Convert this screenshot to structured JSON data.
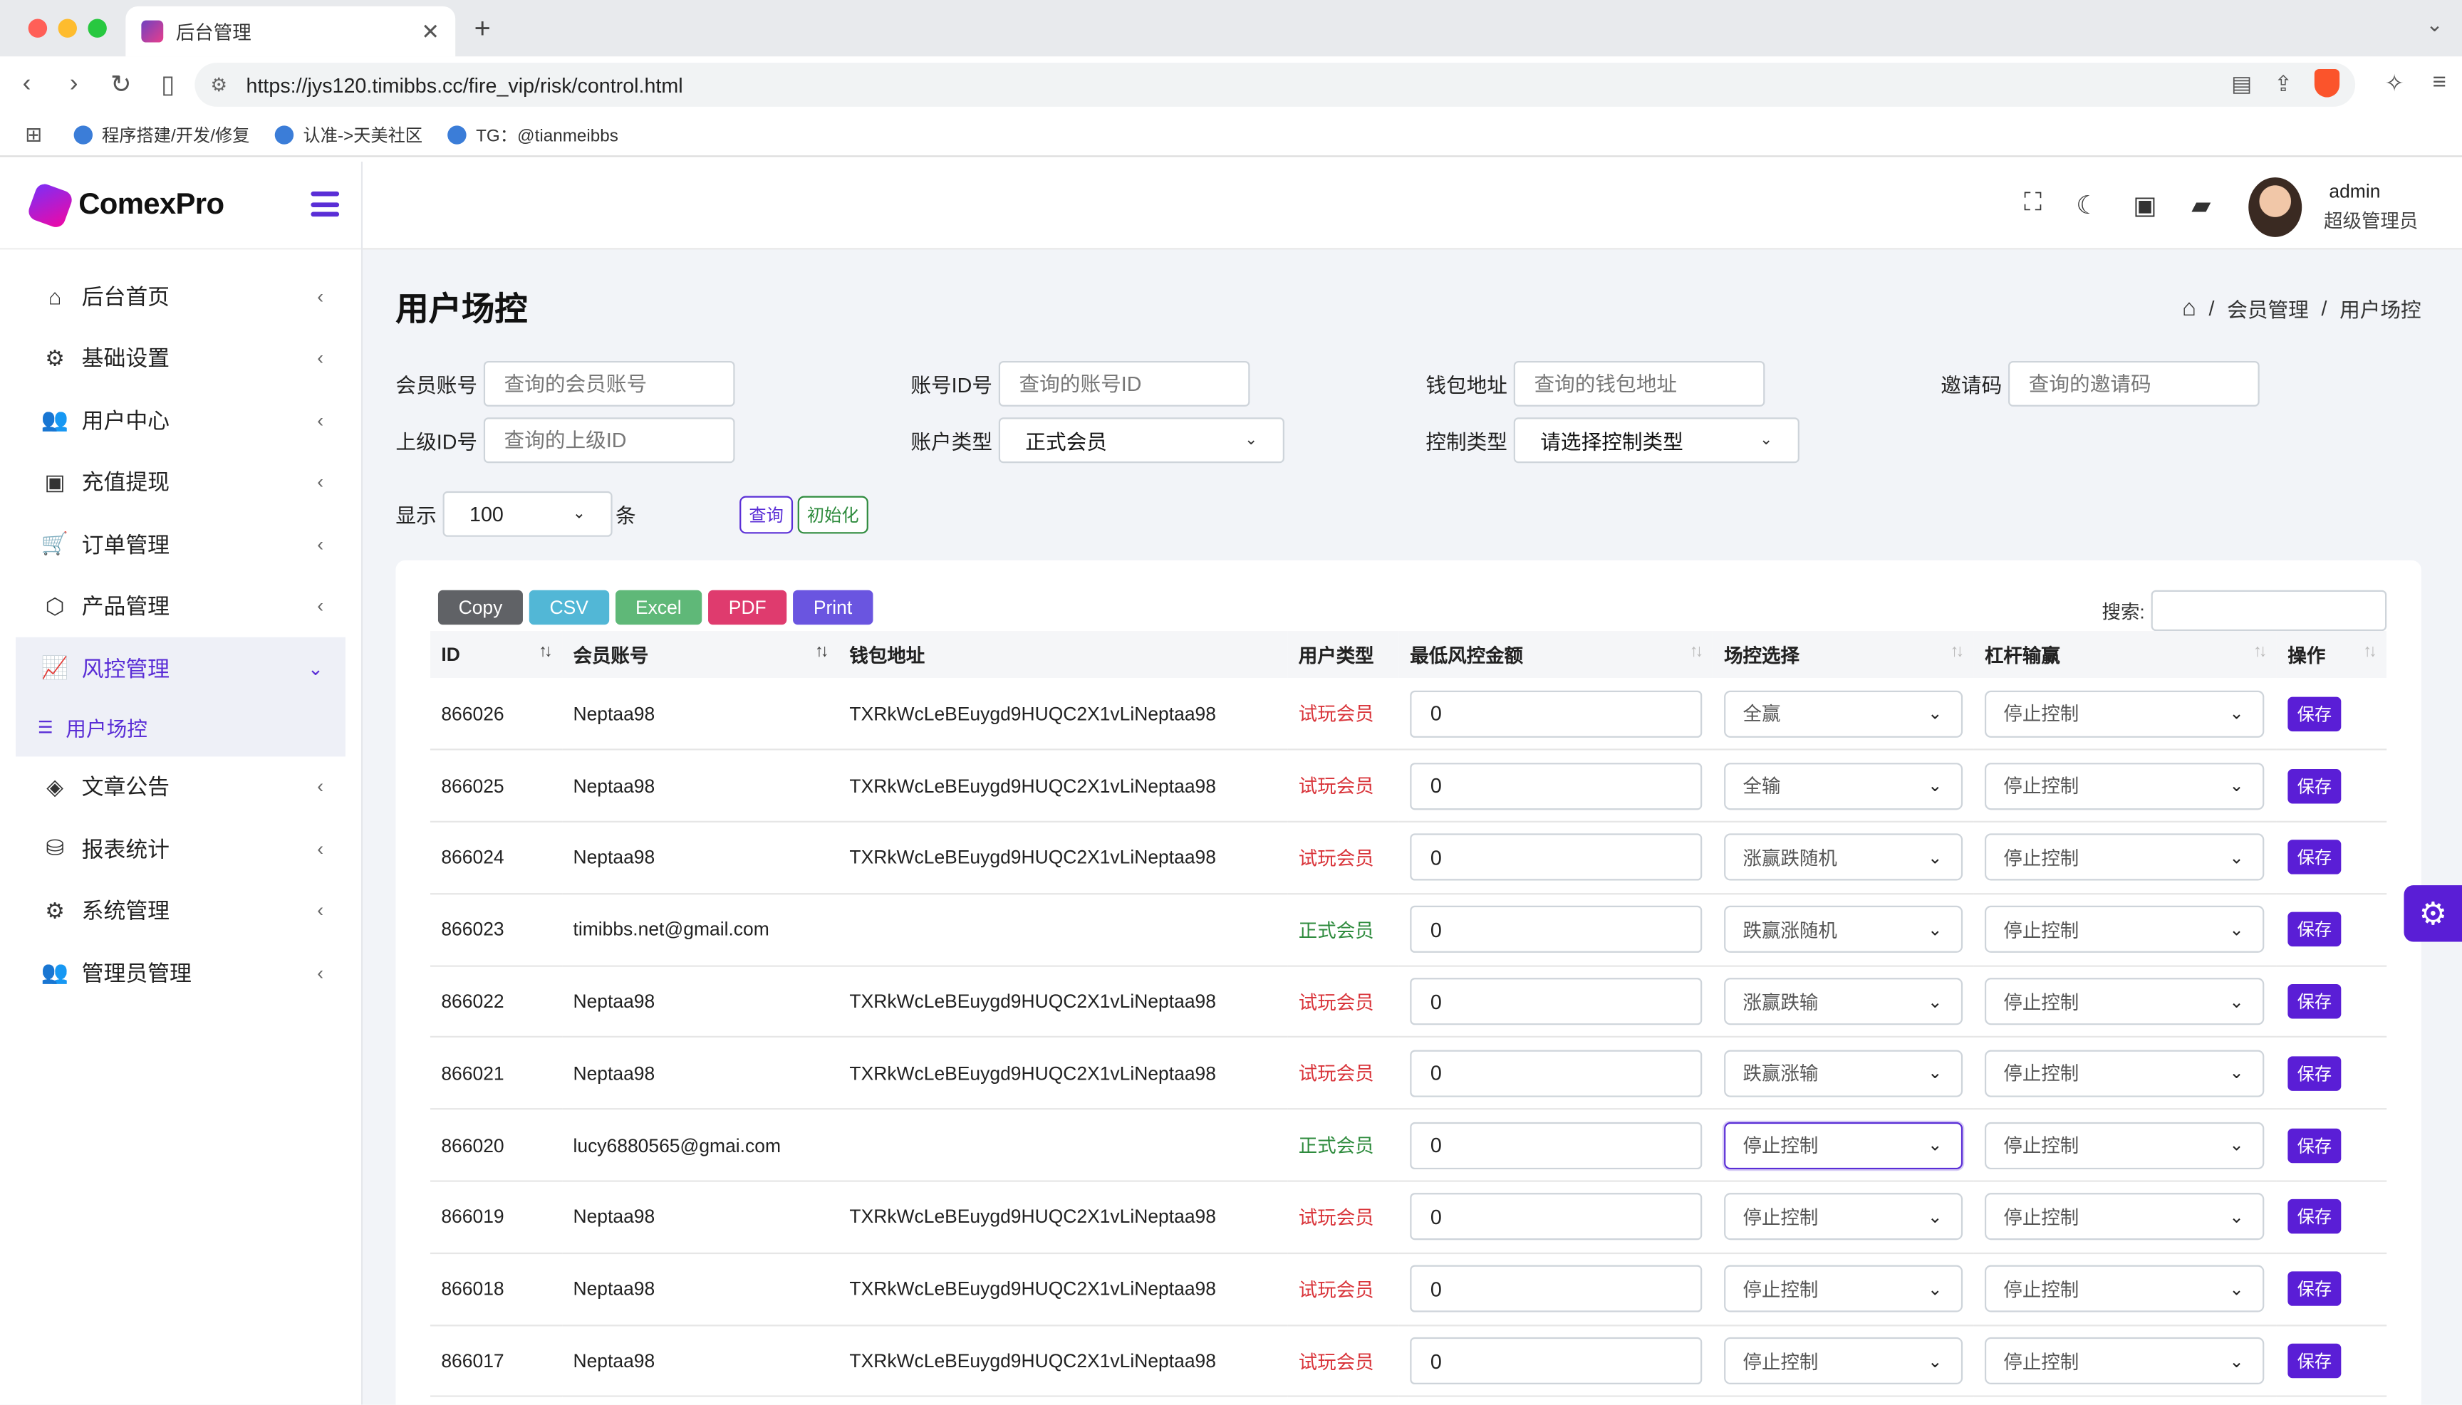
{
  "browser": {
    "tab_title": "后台管理",
    "url": "https://jys120.timibbs.cc/fire_vip/risk/control.html",
    "bookmarks": [
      "程序搭建/开发/修复",
      "认准->天美社区",
      "TG：@tianmeibbs"
    ]
  },
  "brand": {
    "name": "ComexPro"
  },
  "sidebar": {
    "items": [
      {
        "label": "后台首页",
        "icon": "home-icon"
      },
      {
        "label": "基础设置",
        "icon": "cogs-icon"
      },
      {
        "label": "用户中心",
        "icon": "users-icon"
      },
      {
        "label": "充值提现",
        "icon": "money-icon"
      },
      {
        "label": "订单管理",
        "icon": "cart-icon"
      },
      {
        "label": "产品管理",
        "icon": "cubes-icon"
      },
      {
        "label": "风控管理",
        "icon": "chart-line-icon",
        "active": true
      },
      {
        "label": "文章公告",
        "icon": "layers-icon"
      },
      {
        "label": "报表统计",
        "icon": "database-icon"
      },
      {
        "label": "系统管理",
        "icon": "gear-icon"
      },
      {
        "label": "管理员管理",
        "icon": "user-group-icon"
      }
    ],
    "sub_item": "用户场控"
  },
  "user": {
    "name": "admin",
    "role": "超级管理员"
  },
  "page": {
    "title": "用户场控",
    "breadcrumb": [
      "会员管理",
      "用户场控"
    ]
  },
  "filters": {
    "member_account": {
      "label": "会员账号",
      "placeholder": "查询的会员账号"
    },
    "account_id": {
      "label": "账号ID号",
      "placeholder": "查询的账号ID"
    },
    "wallet": {
      "label": "钱包地址",
      "placeholder": "查询的钱包地址"
    },
    "invite": {
      "label": "邀请码",
      "placeholder": "查询的邀请码"
    },
    "parent_id": {
      "label": "上级ID号",
      "placeholder": "查询的上级ID"
    },
    "account_type": {
      "label": "账户类型",
      "value": "正式会员"
    },
    "control_type": {
      "label": "控制类型",
      "value": "请选择控制类型"
    }
  },
  "display": {
    "prefix": "显示",
    "value": "100",
    "suffix": "条"
  },
  "actions": {
    "query": "查询",
    "reset": "初始化"
  },
  "export_buttons": [
    "Copy",
    "CSV",
    "Excel",
    "PDF",
    "Print"
  ],
  "search_label": "搜索:",
  "table": {
    "headers": [
      "ID",
      "会员账号",
      "钱包地址",
      "用户类型",
      "最低风控金额",
      "场控选择",
      "杠杆输赢",
      "操作"
    ],
    "save_label": "保存",
    "rows": [
      {
        "id": "866026",
        "account": "Neptaa98",
        "wallet": "TXRkWcLeBEuygd9HUQC2X1vLiNeptaa98",
        "type": "试玩会员",
        "type_class": "trial",
        "amount": "0",
        "control": "全赢",
        "leverage": "停止控制"
      },
      {
        "id": "866025",
        "account": "Neptaa98",
        "wallet": "TXRkWcLeBEuygd9HUQC2X1vLiNeptaa98",
        "type": "试玩会员",
        "type_class": "trial",
        "amount": "0",
        "control": "全输",
        "leverage": "停止控制"
      },
      {
        "id": "866024",
        "account": "Neptaa98",
        "wallet": "TXRkWcLeBEuygd9HUQC2X1vLiNeptaa98",
        "type": "试玩会员",
        "type_class": "trial",
        "amount": "0",
        "control": "涨赢跌随机",
        "leverage": "停止控制"
      },
      {
        "id": "866023",
        "account": "timibbs.net@gmail.com",
        "wallet": "",
        "type": "正式会员",
        "type_class": "formal",
        "amount": "0",
        "control": "跌赢涨随机",
        "leverage": "停止控制"
      },
      {
        "id": "866022",
        "account": "Neptaa98",
        "wallet": "TXRkWcLeBEuygd9HUQC2X1vLiNeptaa98",
        "type": "试玩会员",
        "type_class": "trial",
        "amount": "0",
        "control": "涨赢跌输",
        "leverage": "停止控制"
      },
      {
        "id": "866021",
        "account": "Neptaa98",
        "wallet": "TXRkWcLeBEuygd9HUQC2X1vLiNeptaa98",
        "type": "试玩会员",
        "type_class": "trial",
        "amount": "0",
        "control": "跌赢涨输",
        "leverage": "停止控制"
      },
      {
        "id": "866020",
        "account": "lucy6880565@gmai.com",
        "wallet": "",
        "type": "正式会员",
        "type_class": "formal",
        "amount": "0",
        "control": "停止控制",
        "leverage": "停止控制",
        "focused": true
      },
      {
        "id": "866019",
        "account": "Neptaa98",
        "wallet": "TXRkWcLeBEuygd9HUQC2X1vLiNeptaa98",
        "type": "试玩会员",
        "type_class": "trial",
        "amount": "0",
        "control": "停止控制",
        "leverage": "停止控制"
      },
      {
        "id": "866018",
        "account": "Neptaa98",
        "wallet": "TXRkWcLeBEuygd9HUQC2X1vLiNeptaa98",
        "type": "试玩会员",
        "type_class": "trial",
        "amount": "0",
        "control": "停止控制",
        "leverage": "停止控制"
      },
      {
        "id": "866017",
        "account": "Neptaa98",
        "wallet": "TXRkWcLeBEuygd9HUQC2X1vLiNeptaa98",
        "type": "试玩会员",
        "type_class": "trial",
        "amount": "0",
        "control": "停止控制",
        "leverage": "停止控制"
      }
    ]
  },
  "colors": {
    "accent": "#5a1ed6",
    "trial": "#d9343a",
    "formal": "#2e8b3d"
  }
}
